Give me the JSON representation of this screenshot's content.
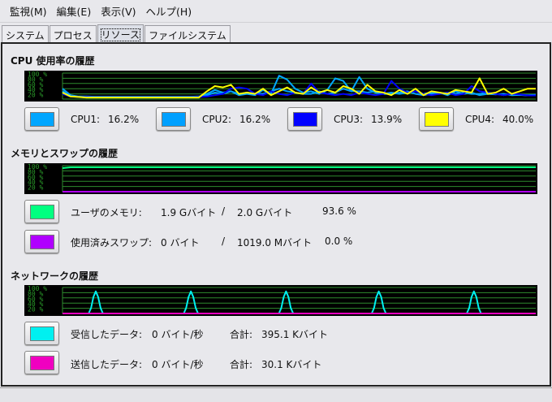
{
  "menu": [
    "監視(M)",
    "編集(E)",
    "表示(V)",
    "ヘルプ(H)"
  ],
  "tabs": [
    "システム",
    "プロセス",
    "リソース",
    "ファイルシステム"
  ],
  "active_tab": 2,
  "axis_labels": [
    "100 %",
    "80 %",
    "60 %",
    "40 %",
    "20 %"
  ],
  "cpu": {
    "title": "CPU 使用率の履歴",
    "items": [
      {
        "name": "CPU1:",
        "value": "16.2%",
        "color": "#00a6ff"
      },
      {
        "name": "CPU2:",
        "value": "16.2%",
        "color": "#00a0ff"
      },
      {
        "name": "CPU3:",
        "value": "13.9%",
        "color": "#0000ff"
      },
      {
        "name": "CPU4:",
        "value": "40.0%",
        "color": "#ffff00"
      }
    ],
    "series": [
      [
        30,
        12,
        8,
        8,
        7,
        7,
        7,
        7,
        7,
        7,
        7,
        7,
        7,
        7,
        7,
        7,
        7,
        7,
        20,
        35,
        25,
        30,
        15,
        20,
        15,
        35,
        20,
        90,
        75,
        40,
        25,
        30,
        20,
        35,
        80,
        70,
        30,
        85,
        40,
        25,
        20,
        20,
        25,
        30,
        20,
        15,
        20,
        25,
        15,
        30,
        20,
        25,
        15,
        20,
        18,
        20,
        15,
        16,
        14,
        16
      ],
      [
        40,
        15,
        10,
        10,
        9,
        9,
        9,
        9,
        9,
        9,
        9,
        9,
        9,
        9,
        9,
        9,
        9,
        10,
        15,
        25,
        20,
        30,
        20,
        25,
        20,
        20,
        30,
        40,
        30,
        25,
        20,
        20,
        30,
        20,
        25,
        40,
        30,
        30,
        25,
        30,
        20,
        25,
        20,
        25,
        30,
        20,
        25,
        20,
        25,
        20,
        25,
        20,
        20,
        25,
        20,
        15,
        20,
        16,
        15,
        16
      ],
      [
        20,
        10,
        8,
        8,
        7,
        7,
        7,
        7,
        7,
        7,
        7,
        7,
        7,
        7,
        7,
        7,
        7,
        8,
        10,
        15,
        20,
        40,
        45,
        40,
        20,
        15,
        30,
        20,
        15,
        25,
        20,
        60,
        25,
        20,
        15,
        20,
        15,
        25,
        20,
        15,
        20,
        70,
        40,
        25,
        30,
        20,
        15,
        20,
        25,
        15,
        20,
        50,
        30,
        25,
        20,
        15,
        20,
        18,
        14,
        14
      ],
      [
        25,
        10,
        8,
        6,
        6,
        6,
        6,
        6,
        6,
        6,
        6,
        6,
        6,
        6,
        6,
        6,
        6,
        6,
        30,
        50,
        45,
        55,
        20,
        25,
        20,
        40,
        15,
        30,
        45,
        25,
        20,
        45,
        25,
        35,
        25,
        50,
        40,
        20,
        55,
        30,
        25,
        15,
        35,
        20,
        40,
        15,
        30,
        25,
        20,
        35,
        30,
        25,
        80,
        20,
        25,
        40,
        20,
        30,
        40,
        40
      ]
    ]
  },
  "memory": {
    "title": "メモリとスワップの履歴",
    "user": {
      "label": "ユーザのメモリ:",
      "used": "1.9 Gバイト",
      "sep": "/",
      "total": "2.0 Gバイト",
      "percent": "93.6 %",
      "color": "#00ff80",
      "level": 93.6
    },
    "swap": {
      "label": "使用済みスワップ:",
      "used": "0 バイト",
      "sep": "/",
      "total": "1019.0 Mバイト",
      "percent": "0.0 %",
      "color": "#b000ff",
      "level": 0
    }
  },
  "network": {
    "title": "ネットワークの履歴",
    "recv": {
      "label": "受信したデータ:",
      "rate": "0 バイト/秒",
      "total_label": "合計:",
      "total": "395.1 Kバイト",
      "color": "#00f0f0"
    },
    "sent": {
      "label": "送信したデータ:",
      "rate": "0 バイト/秒",
      "total_label": "合計:",
      "total": "30.1 Kバイト",
      "color": "#f000c0"
    },
    "recv_peaks": [
      0.07,
      0.27,
      0.47,
      0.67,
      0.87
    ]
  }
}
